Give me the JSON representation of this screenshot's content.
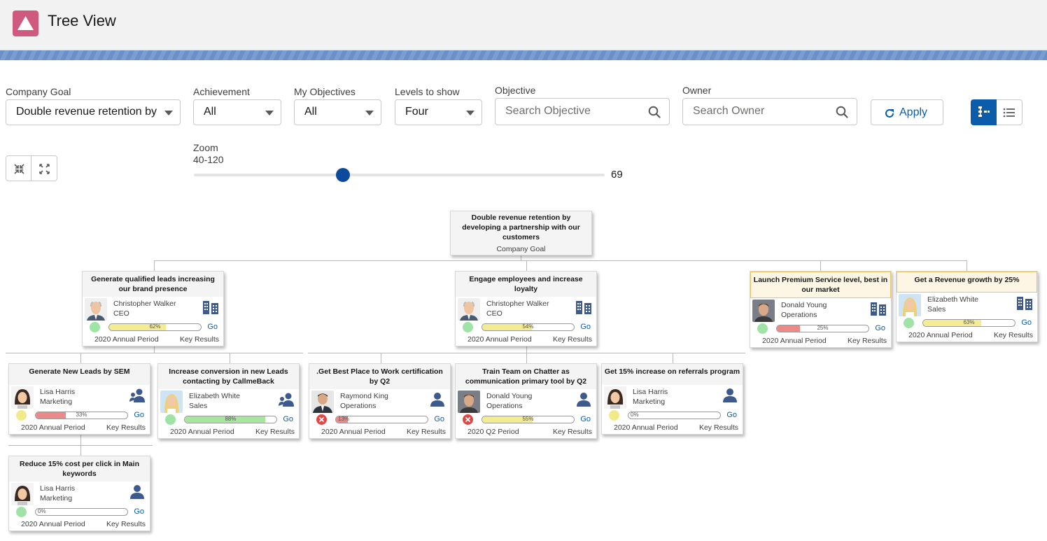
{
  "app": {
    "title": "Tree View",
    "icon": "triangle-icon",
    "icon_color": "#d0597f"
  },
  "filters": {
    "company_goal": {
      "label": "Company Goal",
      "value": "Double revenue retention by"
    },
    "achievement": {
      "label": "Achievement",
      "value": "All"
    },
    "my_objectives": {
      "label": "My Objectives",
      "value": "All"
    },
    "levels": {
      "label": "Levels to show",
      "value": "Four"
    },
    "objective": {
      "label": "Objective",
      "placeholder": "Search Objective"
    },
    "owner": {
      "label": "Owner",
      "placeholder": "Search Owner"
    },
    "apply_label": "Apply"
  },
  "zoom": {
    "label": "Zoom",
    "range": "40-120",
    "min": 40,
    "max": 120,
    "value": 69,
    "value_text": "69"
  },
  "root": {
    "title": "Double revenue retention by developing a partnership with our customers",
    "subtitle": "Company Goal"
  },
  "cards": [
    {
      "id": "c1",
      "title": "Generate qualified leads increasing our brand presence",
      "owner": "Christopher Walker",
      "role": "CEO",
      "progress": 62,
      "pct": "62%",
      "bar": "#f3ec93",
      "dot": "#9fe3a6",
      "dot_icon": "",
      "period": "2020 Annual Period",
      "kr": "Key Results",
      "go": "Go",
      "icon": "building-icon",
      "photo": "man-bald",
      "highlight": false
    },
    {
      "id": "c2",
      "title": "Engage employees and increase loyalty",
      "owner": "Christopher Walker",
      "role": "CEO",
      "progress": 54,
      "pct": "54%",
      "bar": "#f3ec93",
      "dot": "#9fe3a6",
      "dot_icon": "",
      "period": "2020 Annual Period",
      "kr": "Key Results",
      "go": "Go",
      "icon": "building-icon",
      "photo": "man-bald",
      "highlight": false
    },
    {
      "id": "c3",
      "title": "Launch Premium Service level, best in our market",
      "owner": "Donald Young",
      "role": "Operations",
      "progress": 25,
      "pct": "25%",
      "bar": "#ec8a8a",
      "dot": "#9fe3a6",
      "dot_icon": "",
      "period": "2020 Annual Period",
      "kr": "Key Results",
      "go": "Go",
      "icon": "building-icon",
      "photo": "man-young",
      "highlight": true
    },
    {
      "id": "c4",
      "title": "Get a Revenue growth by 25%",
      "owner": "Elizabeth White",
      "role": "Sales",
      "progress": 63,
      "pct": "63%",
      "bar": "#f3ec93",
      "dot": "#9fe3a6",
      "dot_icon": "",
      "period": "2020 Annual Period",
      "kr": "Key Results",
      "go": "Go",
      "icon": "building-icon",
      "photo": "woman-blonde",
      "highlight": true
    },
    {
      "id": "c5",
      "title": "Generate New Leads by SEM",
      "owner": "Lisa Harris",
      "role": "Marketing",
      "progress": 33,
      "pct": "33%",
      "bar": "#ec8a8a",
      "dot": "#f1ea8a",
      "dot_icon": "",
      "period": "2020 Annual Period",
      "kr": "Key Results",
      "go": "Go",
      "icon": "team-icon",
      "photo": "woman-dark",
      "highlight": false
    },
    {
      "id": "c6",
      "title": "Increase conversion in new Leads contacting by CallmeBack",
      "owner": "Elizabeth White",
      "role": "Sales",
      "progress": 88,
      "pct": "88%",
      "bar": "#a8e6a0",
      "dot": "#9fe3a6",
      "dot_icon": "",
      "period": "2020 Annual Period",
      "kr": "Key Results",
      "go": "Go",
      "icon": "team-icon",
      "photo": "woman-blonde",
      "highlight": false
    },
    {
      "id": "c7",
      "title": ".Get Best Place to Work certification by Q2",
      "owner": "Raymond King",
      "role": "Operations",
      "progress": 13,
      "pct": "13%",
      "bar": "#ec8a8a",
      "dot": "#e04848",
      "dot_icon": "close-icon",
      "period": "2020 Annual Period",
      "kr": "Key Results",
      "go": "Go",
      "icon": "user-icon",
      "photo": "man-suit",
      "highlight": false
    },
    {
      "id": "c8",
      "title": "Train Team on Chatter as communication primary tool by Q2",
      "owner": "Donald Young",
      "role": "Operations",
      "progress": 55,
      "pct": "55%",
      "bar": "#f3ec93",
      "dot": "#e04848",
      "dot_icon": "close-icon",
      "period": "2020 Q2 Period",
      "kr": "Key Results",
      "go": "Go",
      "icon": "user-icon",
      "photo": "man-young",
      "highlight": false
    },
    {
      "id": "c9",
      "title": "Get 15% increase on referrals program",
      "owner": "Lisa Harris",
      "role": "Marketing",
      "progress": 0,
      "pct": "0%",
      "bar": "#f3ec93",
      "dot": "#f1ea8a",
      "dot_icon": "",
      "period": "2020 Annual Period",
      "kr": "Key Results",
      "go": "Go",
      "icon": "user-icon",
      "photo": "woman-dark",
      "highlight": false
    },
    {
      "id": "c10",
      "title": "Reduce 15% cost per click in Main keywords",
      "owner": "Lisa Harris",
      "role": "Marketing",
      "progress": 0,
      "pct": "0%",
      "bar": "#f3ec93",
      "dot": "#9fe3a6",
      "dot_icon": "",
      "period": "2020 Annual Period",
      "kr": "Key Results",
      "go": "Go",
      "icon": "user-icon",
      "photo": "woman-dark",
      "highlight": false
    }
  ]
}
